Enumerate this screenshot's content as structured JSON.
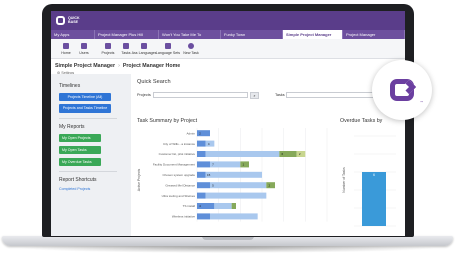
{
  "app": {
    "logo_text_line1": "QUICK",
    "logo_text_line2": "BASE",
    "brand_color": "#5a3d8a",
    "accent_color": "#6b3fa0"
  },
  "tabs": [
    {
      "label": "My Apps",
      "active": false
    },
    {
      "label": "Project Manager Plus Hill",
      "active": false
    },
    {
      "label": "Won't You Take Me To",
      "active": false
    },
    {
      "label": "Funky Town",
      "active": false
    },
    {
      "label": "Simple Project Manager",
      "active": true
    },
    {
      "label": "Project Manager",
      "active": false
    }
  ],
  "toolbar": {
    "items": [
      {
        "label": "Home",
        "icon": "home-icon"
      },
      {
        "label": "Users",
        "icon": "users-icon"
      },
      {
        "label": "Projects",
        "icon": "projects-icon"
      },
      {
        "label": "Tasks",
        "icon": "tasks-icon"
      },
      {
        "label": "Ass Languages",
        "icon": "language-icon"
      },
      {
        "label": "Language Sets",
        "icon": "language-sets-icon"
      },
      {
        "label": "New Task",
        "icon": "plus-icon"
      }
    ]
  },
  "page": {
    "app_name": "Simple Project Manager",
    "page_name": "Project Manager Home",
    "settings_label": "Settings"
  },
  "left": {
    "timelines_heading": "Timelines",
    "timeline_buttons": [
      "Projects Timeline (All)",
      "Projects and Tasks Timeline"
    ],
    "reports_heading": "My Reports",
    "report_buttons": [
      "My Open Projects",
      "My Open Tasks",
      "My Overdue Tasks"
    ],
    "shortcuts_heading": "Report Shortcuts",
    "shortcut_link": "Completed Projects"
  },
  "quick_search": {
    "title": "Quick Search",
    "projects_label": "Projects",
    "tasks_label": "Tasks",
    "search_icon": "search-icon"
  },
  "task_summary": {
    "title": "Task Summary by Project",
    "ylabel": "Active Projects"
  },
  "overdue": {
    "title": "Overdue Tasks by",
    "ylabel": "Number of Tasks"
  },
  "chart_data": [
    {
      "type": "bar",
      "orientation": "horizontal",
      "stacked": true,
      "title": "Task Summary by Project",
      "ylabel": "Active Projects",
      "categories": [
        "Admin",
        "City of Wills - a instance",
        "Customer list, pilot initiative",
        "Facility Document Management",
        "Chosen system upgrade",
        "Greased Mel Distance",
        "Ultra tooling and Shelves",
        "TS install",
        "Wireless initiative"
      ],
      "xlim": [
        0,
        30
      ],
      "series": [
        {
          "values": [
            3,
            2,
            2,
            3,
            2,
            3,
            2,
            4,
            3
          ],
          "color": "#5f8fd9"
        },
        {
          "values": [
            0,
            2,
            17,
            7,
            13,
            13,
            14,
            4,
            11
          ],
          "color": "#a9c8ee"
        },
        {
          "values": [
            0,
            0,
            4,
            2,
            0,
            2,
            0,
            1,
            0
          ],
          "color": "#86a95a"
        },
        {
          "values": [
            0,
            0,
            2,
            0,
            0,
            0,
            0,
            0,
            0
          ],
          "color": "#c8d68f"
        }
      ],
      "data_labels": [
        [
          "2",
          "",
          "",
          ""
        ],
        [
          "",
          "4",
          "",
          ""
        ],
        [
          "",
          "",
          "6",
          "2"
        ],
        [
          "",
          "7",
          "1",
          ""
        ],
        [
          "",
          "15",
          "",
          ""
        ],
        [
          "",
          "5",
          "2",
          ""
        ],
        [
          "",
          "",
          "",
          ""
        ],
        [
          "4",
          "",
          "",
          ""
        ],
        [
          "",
          "",
          "",
          ""
        ]
      ]
    },
    {
      "type": "bar",
      "title": "Overdue Tasks by",
      "ylabel": "Number of Tasks",
      "categories": [
        ""
      ],
      "values": [
        6
      ],
      "data_labels": [
        "6"
      ],
      "ylim": [
        0,
        10
      ],
      "color": "#3a9ad9"
    }
  ]
}
